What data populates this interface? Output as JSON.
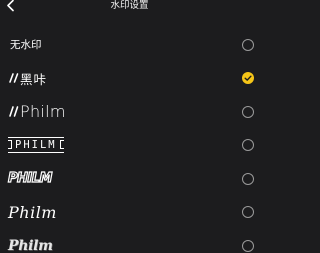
{
  "header": {
    "title": "水印设置"
  },
  "accent_color": "#f5c518",
  "options": [
    {
      "label": "无水印",
      "selected": false
    },
    {
      "label": "黑咔",
      "selected": true
    },
    {
      "label": "Philm",
      "selected": false
    },
    {
      "label": "PHILM",
      "selected": false
    },
    {
      "label": "PHILM",
      "selected": false
    },
    {
      "label": "Philm",
      "selected": false
    },
    {
      "label": "Philm",
      "selected": false
    }
  ]
}
